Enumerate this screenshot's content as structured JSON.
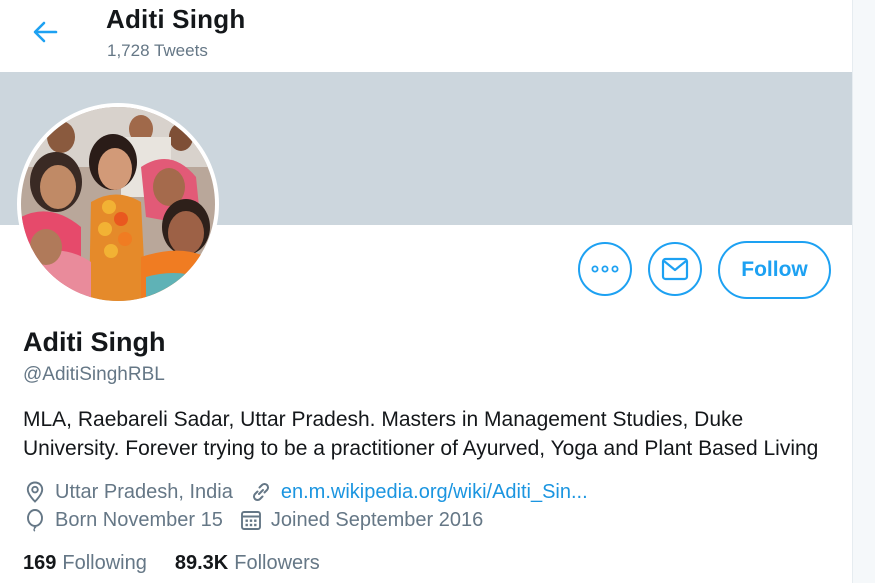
{
  "header": {
    "name": "Aditi Singh",
    "tweet_count": "1,728 Tweets"
  },
  "profile": {
    "name": "Aditi Singh",
    "handle": "@AditiSinghRBL",
    "bio_line1": "MLA, Raebareli Sadar, Uttar Pradesh. Masters in Management Studies, Duke",
    "bio_line2": "University. Forever trying to be a practitioner of Ayurved, Yoga and Plant Based Living",
    "location": "Uttar Pradesh, India",
    "website": "en.m.wikipedia.org/wiki/Aditi_Sin...",
    "birthday": "Born November 15",
    "joined": "Joined September 2016"
  },
  "actions": {
    "follow_label": "Follow"
  },
  "stats": {
    "following_count": "169",
    "following_label": "Following",
    "followers_count": "89.3K",
    "followers_label": "Followers"
  },
  "colors": {
    "accent": "#1da1f2",
    "banner": "#ccd6dd",
    "secondary_text": "#657786"
  },
  "icons": {
    "back": "arrow-left-icon",
    "more": "more-dots-icon",
    "message": "envelope-icon",
    "location": "location-pin-icon",
    "link": "link-icon",
    "birthday": "balloon-icon",
    "joined": "calendar-icon"
  }
}
